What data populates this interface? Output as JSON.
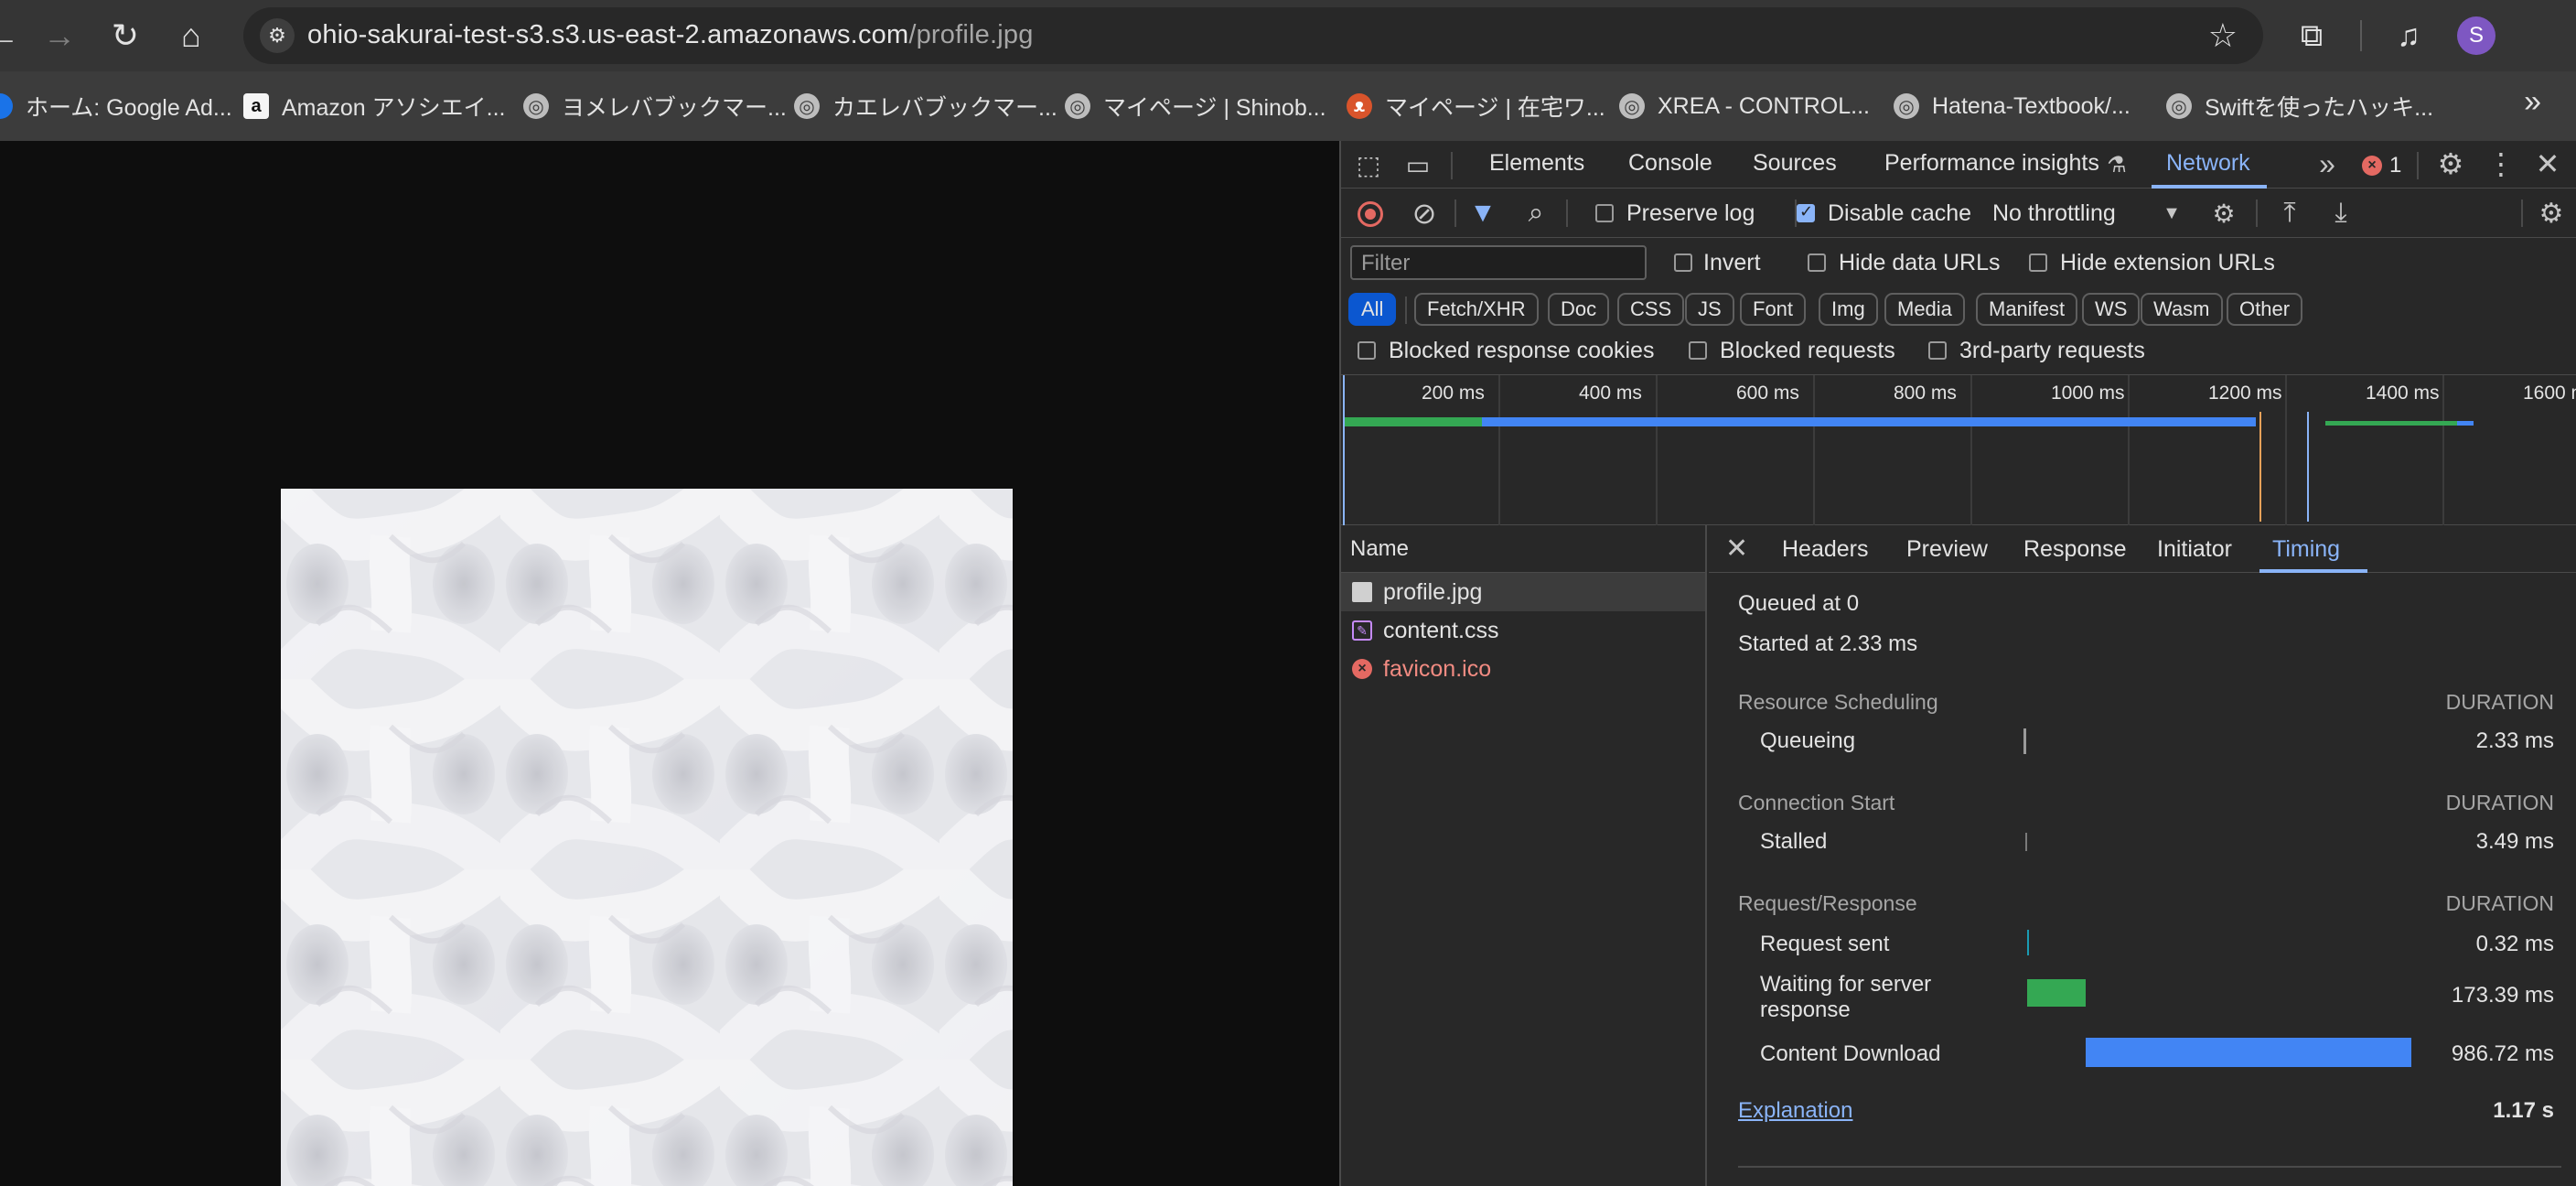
{
  "browser": {
    "url_host": "ohio-sakurai-test-s3.s3.us-east-2.amazonaws.com",
    "url_path": "/profile.jpg",
    "avatar_letter": "S"
  },
  "bookmarks": [
    {
      "label": "ホーム: Google Ad...",
      "icon": "google-ads-icon"
    },
    {
      "label": "Amazon アソシエイ...",
      "icon": "amazon-icon"
    },
    {
      "label": "ヨメレバブックマー...",
      "icon": "globe-icon"
    },
    {
      "label": "カエレバブックマー...",
      "icon": "globe-icon"
    },
    {
      "label": "マイページ | Shinob...",
      "icon": "globe-icon"
    },
    {
      "label": "マイページ | 在宅ワ...",
      "icon": "cat-icon"
    },
    {
      "label": "XREA - CONTROL...",
      "icon": "globe-icon"
    },
    {
      "label": "Hatena-Textbook/...",
      "icon": "globe-icon"
    },
    {
      "label": "Swiftを使ったハッキ...",
      "icon": "globe-icon"
    }
  ],
  "devtools": {
    "tabs": [
      "Elements",
      "Console",
      "Sources",
      "Performance insights",
      "Network"
    ],
    "active_tab": "Network",
    "error_count": "1",
    "toolbar": {
      "preserve_log": "Preserve log",
      "disable_cache": "Disable cache",
      "throttling": "No throttling"
    },
    "filter": {
      "placeholder": "Filter",
      "invert": "Invert",
      "hide_data_urls": "Hide data URLs",
      "hide_extension_urls": "Hide extension URLs"
    },
    "types": [
      "All",
      "Fetch/XHR",
      "Doc",
      "CSS",
      "JS",
      "Font",
      "Img",
      "Media",
      "Manifest",
      "WS",
      "Wasm",
      "Other"
    ],
    "blocked": {
      "cookies": "Blocked response cookies",
      "requests": "Blocked requests",
      "third_party": "3rd-party requests"
    },
    "overview_ticks": [
      "200 ms",
      "400 ms",
      "600 ms",
      "800 ms",
      "1000 ms",
      "1200 ms",
      "1400 ms",
      "1600 ms"
    ],
    "name_header": "Name",
    "requests": [
      {
        "name": "profile.jpg",
        "type": "image"
      },
      {
        "name": "content.css",
        "type": "css"
      },
      {
        "name": "favicon.ico",
        "type": "error"
      }
    ],
    "detail_tabs": [
      "Headers",
      "Preview",
      "Response",
      "Initiator",
      "Timing"
    ],
    "timing": {
      "queued_at": "Queued at 0",
      "started_at": "Started at 2.33 ms",
      "duration_label": "DURATION",
      "sections": [
        {
          "title": "Resource Scheduling",
          "rows": [
            {
              "label": "Queueing",
              "value": "2.33 ms"
            }
          ]
        },
        {
          "title": "Connection Start",
          "rows": [
            {
              "label": "Stalled",
              "value": "3.49 ms"
            }
          ]
        },
        {
          "title": "Request/Response",
          "rows": [
            {
              "label": "Request sent",
              "value": "0.32 ms"
            },
            {
              "label": "Waiting for server response",
              "value": "173.39 ms"
            },
            {
              "label": "Content Download",
              "value": "986.72 ms"
            }
          ]
        }
      ],
      "explanation": "Explanation",
      "total": "1.17 s"
    }
  },
  "colors": {
    "accent": "#8ab4f8",
    "waiting_bar": "#34a853",
    "download_bar": "#4285f4",
    "error": "#e46962"
  }
}
